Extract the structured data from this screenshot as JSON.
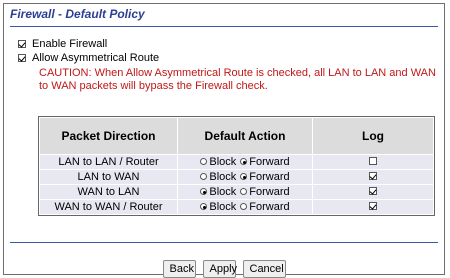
{
  "page": {
    "title": "Firewall - Default Policy"
  },
  "options": {
    "enable_firewall": {
      "label": "Enable Firewall",
      "checked": true
    },
    "allow_asymmetrical": {
      "label": "Allow Asymmetrical Route",
      "checked": true
    },
    "caution": "CAUTION: When Allow Asymmetrical Route is checked, all LAN to LAN and WAN to WAN packets will bypass the Firewall check."
  },
  "table": {
    "headers": [
      "Packet Direction",
      "Default Action",
      "Log"
    ],
    "block_label": "Block",
    "forward_label": "Forward",
    "rows": [
      {
        "direction": "LAN to LAN / Router",
        "action": "Forward",
        "log": false
      },
      {
        "direction": "LAN to WAN",
        "action": "Forward",
        "log": true
      },
      {
        "direction": "WAN to LAN",
        "action": "Block",
        "log": true
      },
      {
        "direction": "WAN to WAN / Router",
        "action": "Block",
        "log": true
      }
    ]
  },
  "buttons": {
    "back": "Back",
    "apply": "Apply",
    "cancel": "Cancel"
  },
  "colors": {
    "title": "#2a3f94",
    "caution": "#c01818",
    "rule": "#3d58a8"
  }
}
